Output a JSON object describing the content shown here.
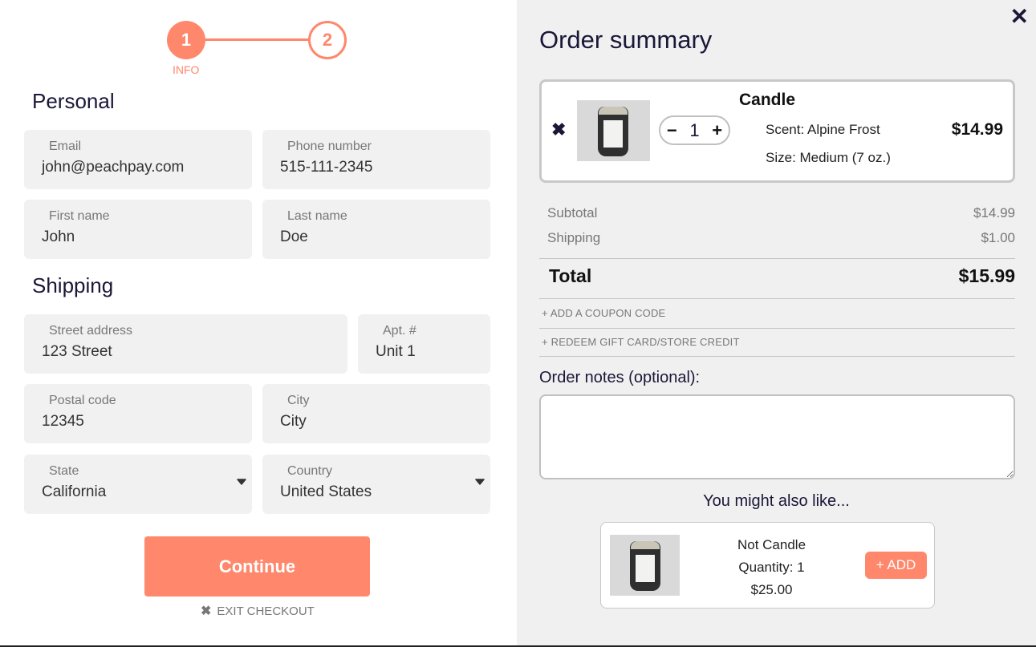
{
  "colors": {
    "accent": "#ff876c",
    "heading": "#1a1738",
    "panel_bg": "#f0f0f0",
    "field_bg": "#f1f1f1"
  },
  "stepper": {
    "steps": [
      {
        "number": "1",
        "label": "INFO",
        "active": true
      },
      {
        "number": "2",
        "label": "",
        "active": false
      }
    ]
  },
  "personal": {
    "title": "Personal",
    "email": {
      "label": "Email",
      "value": "john@peachpay.com"
    },
    "phone": {
      "label": "Phone number",
      "value": "515-111-2345"
    },
    "first_name": {
      "label": "First name",
      "value": "John"
    },
    "last_name": {
      "label": "Last name",
      "value": "Doe"
    }
  },
  "shipping": {
    "title": "Shipping",
    "street": {
      "label": "Street address",
      "value": "123 Street"
    },
    "apt": {
      "label": "Apt. #",
      "value": "Unit 1"
    },
    "postal": {
      "label": "Postal code",
      "value": "12345"
    },
    "city": {
      "label": "City",
      "value": "City"
    },
    "state": {
      "label": "State",
      "value": "California",
      "icon": "caret-down-icon"
    },
    "country": {
      "label": "Country",
      "value": "United States",
      "icon": "caret-down-icon"
    }
  },
  "actions": {
    "continue_label": "Continue",
    "exit_icon": "✖",
    "exit_label": "EXIT CHECKOUT"
  },
  "summary": {
    "close_icon": "✕",
    "title": "Order summary",
    "item": {
      "remove_icon": "✖",
      "name": "Candle",
      "quantity": "1",
      "decrement": "−",
      "increment": "+",
      "variants": [
        "Scent: Alpine Frost",
        "Size: Medium (7 oz.)"
      ],
      "price": "$14.99"
    },
    "subtotal": {
      "label": "Subtotal",
      "value": "$14.99"
    },
    "shipping": {
      "label": "Shipping",
      "value": "$1.00"
    },
    "total": {
      "label": "Total",
      "value": "$15.99"
    },
    "coupon_link": "+ ADD A COUPON CODE",
    "gift_link": "+ REDEEM GIFT CARD/STORE CREDIT",
    "notes_label": "Order notes (optional):",
    "notes_value": ""
  },
  "upsell": {
    "title": "You might also like...",
    "item": {
      "name": "Not Candle",
      "quantity": "Quantity: 1",
      "price": "$25.00",
      "add_label": "+ ADD"
    }
  }
}
